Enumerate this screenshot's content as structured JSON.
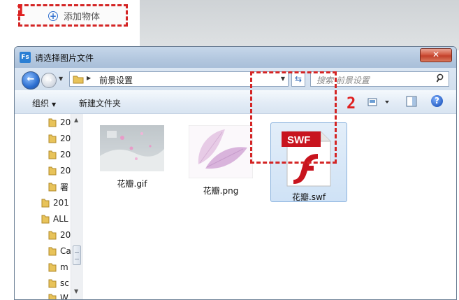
{
  "host": {
    "add_object_label": "添加物体",
    "annotation_1": "1"
  },
  "dialog": {
    "app_icon_text": "Fs",
    "title": "请选择图片文件",
    "close_symbol": "✕"
  },
  "address": {
    "path_segment": "前景设置",
    "search_placeholder": "搜索 前景设置"
  },
  "toolbar": {
    "organize_label": "组织",
    "new_folder_label": "新建文件夹",
    "help_symbol": "?"
  },
  "nav": {
    "items": [
      {
        "label": "20"
      },
      {
        "label": "20"
      },
      {
        "label": "20"
      },
      {
        "label": "20"
      },
      {
        "label": "署"
      },
      {
        "label": "201"
      },
      {
        "label": "ALL"
      },
      {
        "label": "20"
      },
      {
        "label": "Ca"
      },
      {
        "label": "m"
      },
      {
        "label": "sc"
      },
      {
        "label": "W"
      }
    ]
  },
  "files": [
    {
      "name": "花瓣.gif"
    },
    {
      "name": "花瓣.png"
    },
    {
      "name": "花瓣.swf",
      "badge": "SWF"
    }
  ],
  "annotation_2": "2",
  "colors": {
    "annotation_red": "#d42525",
    "selection_blue": "#cfe2f6",
    "swf_red": "#c8141e"
  }
}
